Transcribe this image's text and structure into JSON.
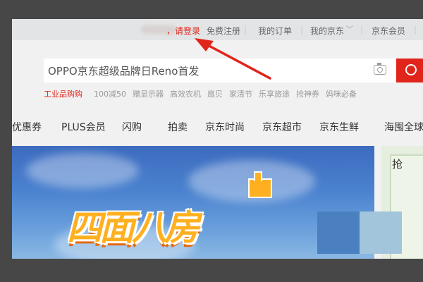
{
  "topbar": {
    "comma": "，",
    "login": "请登录",
    "register": "免费注册",
    "orders": "我的订单",
    "my_jd": "我的京东",
    "vip": "京东会员",
    "sep": "|"
  },
  "search": {
    "placeholder": "OPPO京东超级品牌日Reno首发"
  },
  "hotwords": [
    "工业品购购",
    "100减50",
    "赠显示器",
    "高效农机",
    "扇贝",
    "家清节",
    "乐享旅途",
    "抢神券",
    "妈咪必备"
  ],
  "nav": {
    "items": [
      "优惠券",
      "PLUS会员",
      "闪购",
      "拍卖",
      "京东时尚",
      "京东超市",
      "京东生鲜",
      "海囤全球"
    ]
  },
  "banner": {
    "title": "四面八房"
  },
  "right_panel": {
    "text": "抢"
  },
  "colors": {
    "accent": "#e1251b",
    "banner_text": "#ffb020",
    "arrow": "#e1251b"
  }
}
